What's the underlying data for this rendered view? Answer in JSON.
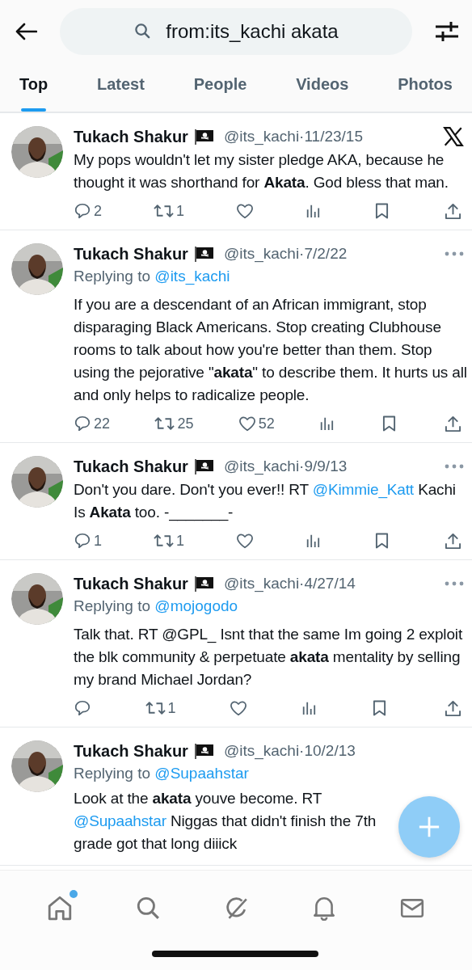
{
  "search": {
    "value": "from:its_kachi akata"
  },
  "tabs": [
    {
      "label": "Top",
      "selected": true
    },
    {
      "label": "Latest",
      "selected": false
    },
    {
      "label": "People",
      "selected": false
    },
    {
      "label": "Videos",
      "selected": false
    },
    {
      "label": "Photos",
      "selected": false
    }
  ],
  "tweets": [
    {
      "name": "Tukach Shakur",
      "handle": "@its_kachi",
      "separator": "·",
      "date": "11/23/15",
      "x_logo": true,
      "more_menu": false,
      "body": [
        {
          "kind": "text",
          "text": "My pops wouldn't let my sister pledge AKA, because he thought it was shorthand for **Akata**. God bless that man."
        }
      ],
      "replies": "2",
      "retweets": "1"
    },
    {
      "name": "Tukach Shakur",
      "handle": "@its_kachi",
      "separator": "·",
      "date": "7/2/22",
      "x_logo": false,
      "more_menu": true,
      "replying_prefix": "Replying to",
      "replying_to": "@its_kachi",
      "body": [
        {
          "kind": "text",
          "text": "If you are a descendant of an African immigrant, stop disparaging Black Americans. Stop creating Clubhouse rooms to talk about how you're better than them. Stop using the pejorative \"**akata**\" to describe them. It hurts us all and only helps to radicalize people."
        }
      ],
      "replies": "22",
      "retweets": "25",
      "likes": "52"
    },
    {
      "name": "Tukach Shakur",
      "handle": "@its_kachi",
      "separator": "·",
      "date": "9/9/13",
      "x_logo": false,
      "more_menu": true,
      "body": [
        {
          "kind": "text",
          "text": "Don't you dare. Don't you ever!! RT "
        },
        {
          "kind": "mention",
          "text": "@Kimmie_Katt"
        },
        {
          "kind": "text",
          "text": " Kachi Is **Akata** too. -_______-"
        }
      ],
      "replies": "1",
      "retweets": "1"
    },
    {
      "name": "Tukach Shakur",
      "handle": "@its_kachi",
      "separator": "·",
      "date": "4/27/14",
      "x_logo": false,
      "more_menu": true,
      "replying_prefix": "Replying to",
      "replying_to": "@mojogodo",
      "body": [
        {
          "kind": "text",
          "text": "Talk that. RT @GPL_ Isnt that the same Im going 2 exploit the blk community & perpetuate **akata** mentality by selling my brand Michael Jordan?"
        }
      ],
      "retweets": "1"
    },
    {
      "name": "Tukach Shakur",
      "handle": "@its_kachi",
      "separator": "·",
      "date": "10/2/13",
      "x_logo": false,
      "more_menu": false,
      "replying_prefix": "Replying to",
      "replying_to": "@Supaahstar",
      "body": [
        {
          "kind": "text",
          "text": "Look at the **akata** youve become. RT "
        },
        {
          "kind": "mention",
          "text": "@Supaahstar"
        },
        {
          "kind": "text",
          "text": " Niggas that didn't finish the 7th grade got that long diiick"
        }
      ]
    }
  ],
  "nav": [
    {
      "kind": "home",
      "badge": true
    },
    {
      "kind": "search",
      "badge": false
    },
    {
      "kind": "grok",
      "badge": false
    },
    {
      "kind": "bell",
      "badge": false
    },
    {
      "kind": "mail",
      "badge": false
    }
  ]
}
